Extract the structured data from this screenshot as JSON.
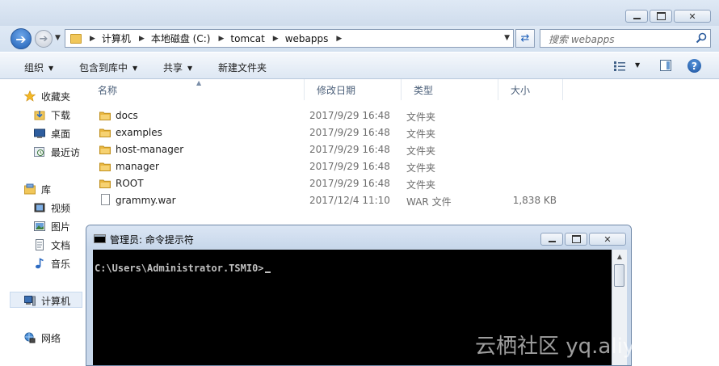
{
  "explorer": {
    "address_path": [
      "计算机",
      "本地磁盘 (C:)",
      "tomcat",
      "webapps"
    ],
    "search_placeholder": "搜索 webapps",
    "toolbar": {
      "organize": "组织",
      "include_in_library": "包含到库中",
      "share": "共享",
      "new_folder": "新建文件夹"
    },
    "columns": {
      "name": "名称",
      "date": "修改日期",
      "type": "类型",
      "size": "大小"
    },
    "files": [
      {
        "name": "docs",
        "date": "2017/9/29 16:48",
        "type": "文件夹",
        "size": "",
        "icon": "folder-icon"
      },
      {
        "name": "examples",
        "date": "2017/9/29 16:48",
        "type": "文件夹",
        "size": "",
        "icon": "folder-icon"
      },
      {
        "name": "host-manager",
        "date": "2017/9/29 16:48",
        "type": "文件夹",
        "size": "",
        "icon": "folder-icon"
      },
      {
        "name": "manager",
        "date": "2017/9/29 16:48",
        "type": "文件夹",
        "size": "",
        "icon": "folder-icon"
      },
      {
        "name": "ROOT",
        "date": "2017/9/29 16:48",
        "type": "文件夹",
        "size": "",
        "icon": "folder-icon"
      },
      {
        "name": "grammy.war",
        "date": "2017/12/4 11:10",
        "type": "WAR 文件",
        "size": "1,838 KB",
        "icon": "file-icon"
      }
    ],
    "sidebar": {
      "favorites": {
        "label": "收藏夹",
        "items": [
          "下载",
          "桌面",
          "最近访"
        ]
      },
      "libraries": {
        "label": "库",
        "items": [
          "视频",
          "图片",
          "文档",
          "音乐"
        ]
      },
      "computer": "计算机",
      "network": "网络"
    }
  },
  "cmd_window": {
    "title": "管理员: 命令提示符",
    "prompt": "C:\\Users\\Administrator.TSMI0>"
  },
  "watermark": "云栖社区 yq.aliyun.com",
  "colors": {
    "accent": "#1f5fb5",
    "folder": "#f1c75a",
    "console_bg": "#000000",
    "console_fg": "#c0c0c0"
  }
}
